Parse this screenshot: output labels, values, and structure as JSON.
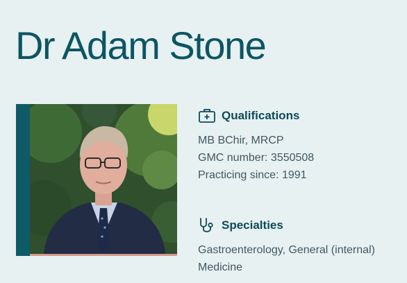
{
  "doctor": {
    "name": "Dr Adam Stone"
  },
  "qualifications": {
    "heading": "Qualifications",
    "icon": "medical-briefcase-icon",
    "lines": [
      "MB BChir, MRCP",
      "GMC number: 3550508",
      "Practicing since: 1991"
    ]
  },
  "specialties": {
    "heading": "Specialties",
    "icon": "stethoscope-icon",
    "lines": [
      "Gastroenterology, General (internal)",
      "Medicine"
    ]
  },
  "colors": {
    "accent": "#0d5563",
    "background": "#e7f1f2",
    "photo_frame": "#0f5a67",
    "photo_underline": "#d69a8e"
  }
}
